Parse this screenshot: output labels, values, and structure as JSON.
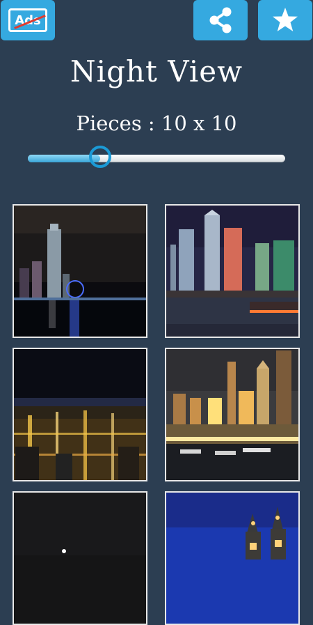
{
  "header": {
    "ads_label": "Ads",
    "title": "Night View"
  },
  "pieces": {
    "label": "Pieces : 10 x 10",
    "slider_level": 0.28
  },
  "icons": {
    "ads": "no-ads-icon",
    "share": "share-icon",
    "star": "star-icon"
  },
  "colors": {
    "background": "#2c3e52",
    "accent": "#35a9e0",
    "slider_thumb": "#1b9ad6"
  },
  "gallery": {
    "images": [
      "city-night-ferris-wheel",
      "skyscrapers-waterfront",
      "aerial-city-lights",
      "harbor-skyline-dusk",
      "dark-sky-tower",
      "blue-sky-church-spires"
    ]
  }
}
